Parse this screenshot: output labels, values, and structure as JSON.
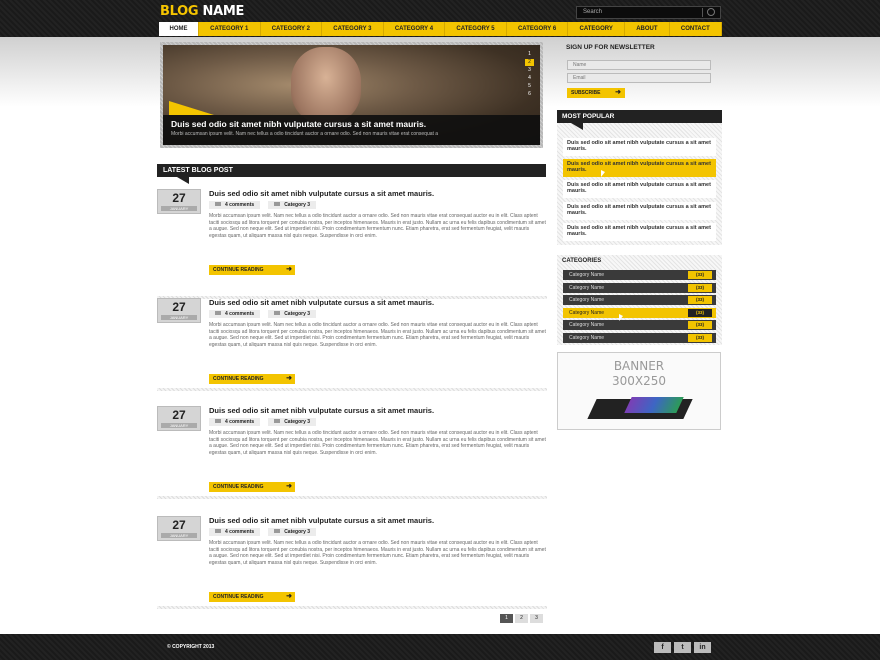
{
  "header": {
    "logo_part1": "BLOG",
    "logo_part2": "NAME",
    "search_placeholder": "Search"
  },
  "nav": [
    "HOME",
    "CATEGORY 1",
    "CATEGORY 2",
    "CATEGORY 3",
    "CATEGORY 4",
    "CATEGORY 5",
    "CATEGORY 6",
    "CATEGORY",
    "ABOUT",
    "CONTACT"
  ],
  "slider": {
    "caption_title": "Duis sed odio sit amet nibh vulputate cursus a sit amet mauris.",
    "caption_text": "Morbi accumsan ipsum velit. Nam nec tellus a odio tincidunt auctor a ornare odio. Sed non mauris vitae erat consequat a",
    "pages": [
      "1",
      "2",
      "3",
      "4",
      "5",
      "6"
    ],
    "active_page": "2"
  },
  "latest": {
    "heading": "LATEST BLOG POST"
  },
  "posts": [
    {
      "day": "27",
      "month": "JANUARY",
      "title": "Duis sed odio sit amet nibh vulputate cursus a sit amet mauris.",
      "comments": "4 comments",
      "category": "Category 3",
      "text": "Morbi accumsan ipsum velit. Nam nec tellus a odio tincidunt auctor a ornare odio. Sed non mauris vitae erat consequat auctor eu in elit. Class aptent taciti sociosqu ad litora torquent per conubia nostra, per inceptos himenaeos. Mauris in erat justo. Nullam ac urna eu felis dapibus condimentum sit amet a augue. Sed non neque elit. Sed ut imperdiet nisi. Proin condimentum fermentum nunc. Etiam pharetra, erat sed fermentum feugiat, velit mauris egestas quam, ut aliquam massa nisl quis neque. Suspendisse in orci enim.",
      "more": "CONTINUE READING"
    },
    {
      "day": "27",
      "month": "JANUARY",
      "title": "Duis sed odio sit amet nibh vulputate cursus a sit amet mauris.",
      "comments": "4 comments",
      "category": "Category 3",
      "text": "Morbi accumsan ipsum velit. Nam nec tellus a odio tincidunt auctor a ornare odio. Sed non mauris vitae erat consequat auctor eu in elit. Class aptent taciti sociosqu ad litora torquent per conubia nostra, per inceptos himenaeos. Mauris in erat justo. Nullam ac urna eu felis dapibus condimentum sit amet a augue. Sed non neque elit. Sed ut imperdiet nisi. Proin condimentum fermentum nunc. Etiam pharetra, erat sed fermentum feugiat, velit mauris egestas quam, ut aliquam massa nisl quis neque. Suspendisse in orci enim.",
      "more": "CONTINUE READING"
    },
    {
      "day": "27",
      "month": "JANUARY",
      "title": "Duis sed odio sit amet nibh vulputate cursus a sit amet mauris.",
      "comments": "4 comments",
      "category": "Category 3",
      "text": "Morbi accumsan ipsum velit. Nam nec tellus a odio tincidunt auctor a ornare odio. Sed non mauris vitae erat consequat auctor eu in elit. Class aptent taciti sociosqu ad litora torquent per conubia nostra, per inceptos himenaeos. Mauris in erat justo. Nullam ac urna eu felis dapibus condimentum sit amet a augue. Sed non neque elit. Sed ut imperdiet nisi. Proin condimentum fermentum nunc. Etiam pharetra, erat sed fermentum feugiat, velit mauris egestas quam, ut aliquam massa nisl quis neque. Suspendisse in orci enim.",
      "more": "CONTINUE READING"
    },
    {
      "day": "27",
      "month": "JANUARY",
      "title": "Duis sed odio sit amet nibh vulputate cursus a sit amet mauris.",
      "comments": "4 comments",
      "category": "Category 3",
      "text": "Morbi accumsan ipsum velit. Nam nec tellus a odio tincidunt auctor a ornare odio. Sed non mauris vitae erat consequat auctor eu in elit. Class aptent taciti sociosqu ad litora torquent per conubia nostra, per inceptos himenaeos. Mauris in erat justo. Nullam ac urna eu felis dapibus condimentum sit amet a augue. Sed non neque elit. Sed ut imperdiet nisi. Proin condimentum fermentum nunc. Etiam pharetra, erat sed fermentum feugiat, velit mauris egestas quam, ut aliquam massa nisl quis neque. Suspendisse in orci enim.",
      "more": "CONTINUE READING"
    }
  ],
  "pagination": [
    "1",
    "2",
    "3"
  ],
  "newsletter": {
    "heading": "SIGN UP FOR NEWSLETTER",
    "name_placeholder": "Name",
    "email_placeholder": "Email",
    "button": "SUBSCRIBE"
  },
  "popular": {
    "heading": "MOST POPULAR",
    "items": [
      "Duis sed odio sit amet nibh vulputate cursus a sit amet mauris.",
      "Duis sed odio sit amet nibh vulputate cursus a sit amet mauris.",
      "Duis sed odio sit amet nibh vulputate cursus a sit amet mauris.",
      "Duis sed odio sit amet nibh vulputate cursus a sit amet mauris.",
      "Duis sed odio sit amet nibh vulputate cursus a sit amet mauris."
    ]
  },
  "categories": {
    "heading": "CATEGORIES",
    "items": [
      {
        "name": "Category Name",
        "count": "(33)"
      },
      {
        "name": "Category Name",
        "count": "(33)"
      },
      {
        "name": "Category Name",
        "count": "(33)"
      },
      {
        "name": "Category Name",
        "count": "(33)"
      },
      {
        "name": "Category Name",
        "count": "(33)"
      },
      {
        "name": "Category Name",
        "count": "(33)"
      }
    ]
  },
  "banner": {
    "line1": "BANNER",
    "line2": "300X250"
  },
  "footer": {
    "copyright": "© COPYRIGHT 2013",
    "social": [
      "f",
      "t",
      "in"
    ]
  },
  "colors": {
    "accent": "#f3c400",
    "dark": "#222222"
  }
}
